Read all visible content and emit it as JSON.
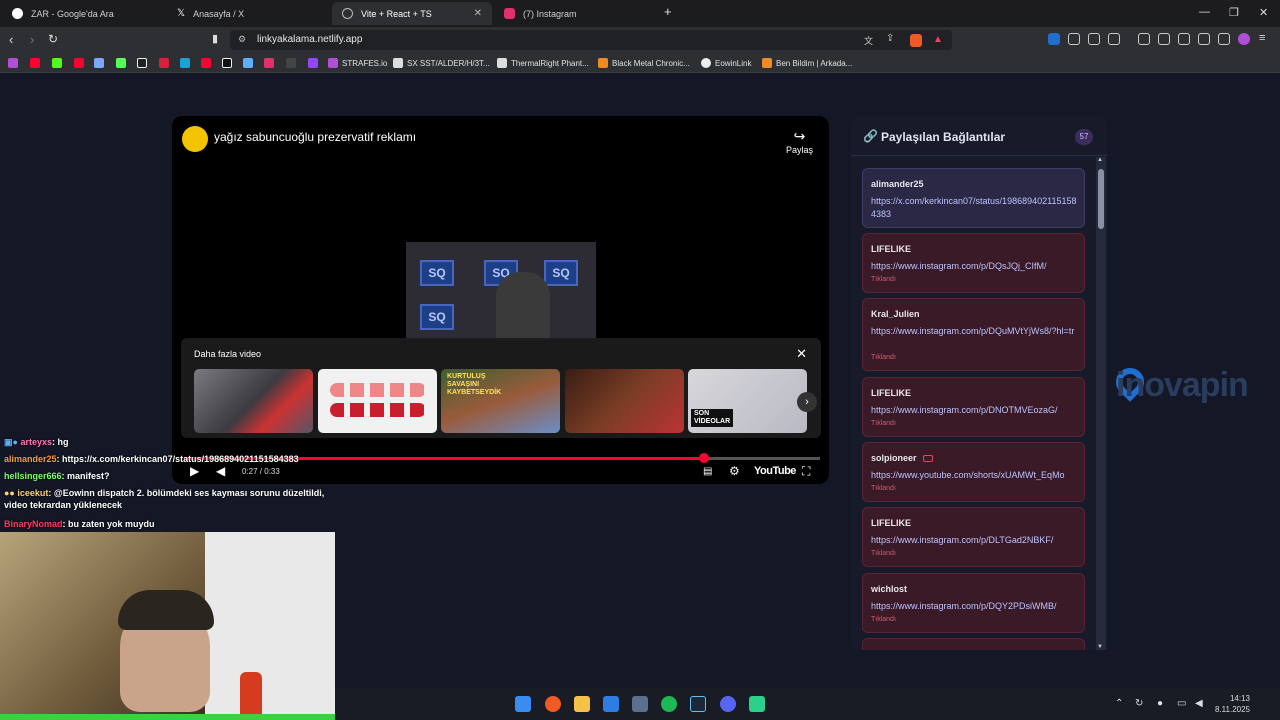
{
  "browser": {
    "tabs": [
      {
        "title": "ZAR - Google'da Ara",
        "color": "#ffffff"
      },
      {
        "title": "Anasayfa / X",
        "color": "#e6e6e6"
      },
      {
        "title": "Vite + React + TS",
        "color": "#9aa0a6"
      },
      {
        "title": "(7) Instagram",
        "color": "#e1306c"
      }
    ],
    "new_tab": "+",
    "url": "linkyakalama.netlify.app",
    "bookmarks": [
      "STRAFES.io",
      "SX SST/ALDER/H/3T...",
      "ThermalRight Phant...",
      "Black Metal Chronic...",
      "EowinLink",
      "Ben Bildim | Arkada..."
    ]
  },
  "video": {
    "title": "yağız sabuncuoğlu prezervatif reklamı",
    "share_label": "Paylaş",
    "frame_tiles": [
      "SQ",
      "SQ",
      "SQ",
      "SQ"
    ],
    "more_videos_title": "Daha fazla video",
    "son_videolar": "SON\nVİDEOLAR",
    "thumb3_text": "KURTULUŞ SAVAŞINI KAYBETSEYDİK",
    "time": "0:27 / 0:33",
    "progress_fraction": 0.8182,
    "youtube_label": "YouTube"
  },
  "links_panel": {
    "title": "Paylaşılan Bağlantılar",
    "count": "57",
    "items": [
      {
        "user": "alimander25",
        "url": "https://x.com/kerkincan07/status/1986894021151584383",
        "status": ""
      },
      {
        "user": "LIFELIKE",
        "url": "https://www.instagram.com/p/DQsJQj_CIfM/",
        "status": "Tıklandı"
      },
      {
        "user": "Kral_Julien",
        "url": "https://www.instagram.com/p/DQuMVtYjWs8/?hl=tr",
        "status": "Tıklandı"
      },
      {
        "user": "LIFELIKE",
        "url": "https://www.instagram.com/p/DNOTMVEozaG/",
        "status": "Tıklandı"
      },
      {
        "user": "solpioneer",
        "url": "https://www.youtube.com/shorts/xUAMWt_EqMo",
        "status": "Tıklandı"
      },
      {
        "user": "LIFELIKE",
        "url": "https://www.instagram.com/p/DLTGad2NBKF/",
        "status": "Tıklandı"
      },
      {
        "user": "wichlost",
        "url": "https://www.instagram.com/p/DQY2PDsiWMB/",
        "status": "Tıklandı"
      }
    ]
  },
  "chat": [
    {
      "user": "arteyxs",
      "message": ": hg",
      "color": "#ff7ab6"
    },
    {
      "user": "alimander25",
      "message": ": https://x.com/kerkincan07/status/1986894021151584383",
      "color": "#ff9a3c"
    },
    {
      "user": "hellsinger666",
      "message": ": manifest?",
      "color": "#7dff6b"
    },
    {
      "user": "iceekut",
      "message": ": @Eowinn dispatch 2. bölümdeki ses kayması sorunu düzeltildi, video tekrardan yüklenecek",
      "color": "#ffd27a"
    },
    {
      "user": "BinaryNomad",
      "message": ": bu zaten yok muydu",
      "color": "#ff3b5c"
    }
  ],
  "background_logo": "inovapin",
  "taskbar": {
    "time": "14:13",
    "date": "8.11.2025"
  }
}
